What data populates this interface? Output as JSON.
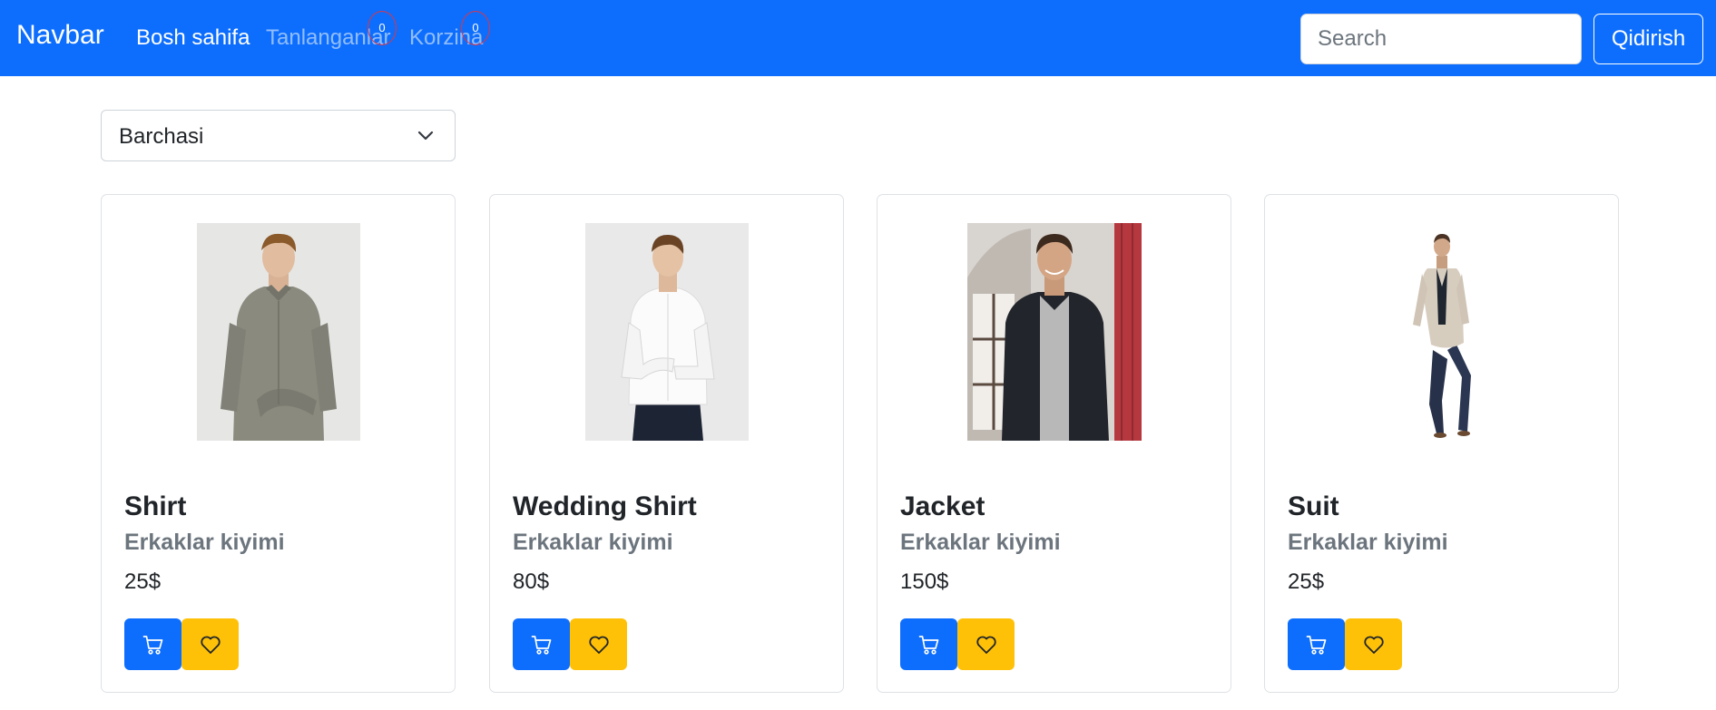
{
  "navbar": {
    "brand": "Navbar",
    "links": [
      {
        "label": "Bosh sahifa",
        "active": true
      },
      {
        "label": "Tanlanganlar",
        "active": false,
        "badge": "0"
      },
      {
        "label": "Korzina",
        "active": false,
        "badge": "0"
      }
    ],
    "search_placeholder": "Search",
    "search_button": "Qidirish",
    "color": "#0d6efd"
  },
  "filter": {
    "selected": "Barchasi",
    "icon": "chevron-down-icon"
  },
  "products": [
    {
      "title": "Shirt",
      "category": "Erkaklar kiyimi",
      "price": "25$",
      "image": "man-in-grey-shirt"
    },
    {
      "title": "Wedding Shirt",
      "category": "Erkaklar kiyimi",
      "price": "80$",
      "image": "man-in-white-shirt"
    },
    {
      "title": "Jacket",
      "category": "Erkaklar kiyimi",
      "price": "150$",
      "image": "man-in-leather-jacket"
    },
    {
      "title": "Suit",
      "category": "Erkaklar kiyimi",
      "price": "25$",
      "image": "man-in-beige-suit"
    }
  ],
  "buttons": {
    "cart_icon": "cart-icon",
    "like_icon": "heart-icon",
    "cart_color": "#0d6efd",
    "like_color": "#ffc107"
  }
}
